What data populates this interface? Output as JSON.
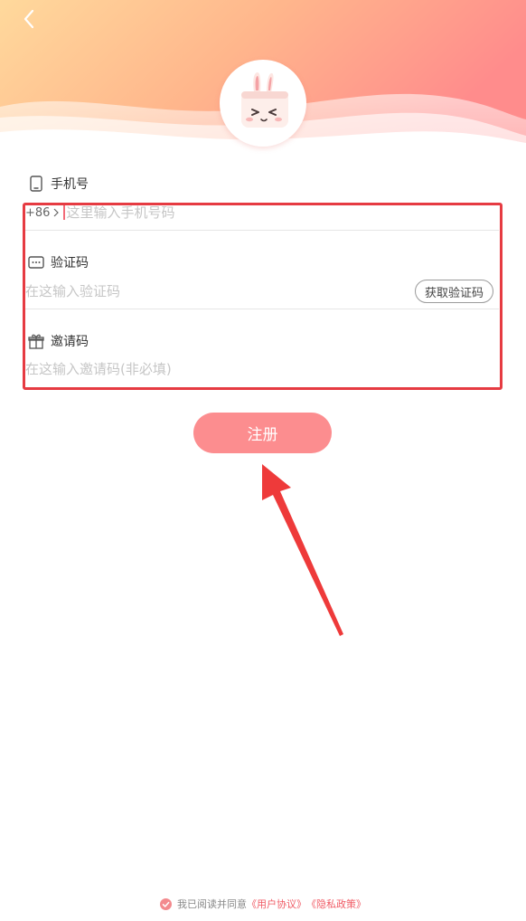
{
  "theme": {
    "accent": "#f26b78",
    "button_color": "#fc8d8f",
    "header_gradient": [
      "#ffd79a",
      "#ffa98a",
      "#ff8a8a"
    ],
    "highlight_color": "#e63b42"
  },
  "header": {
    "back_icon": "chevron-left-icon",
    "avatar": "bunny-mascot"
  },
  "form": {
    "phone": {
      "label": "手机号",
      "icon": "phone-icon",
      "country_code": "+86",
      "placeholder": "这里输入手机号码",
      "value": ""
    },
    "code": {
      "label": "验证码",
      "icon": "message-icon",
      "placeholder": "在这输入验证码",
      "value": "",
      "get_code_label": "获取验证码"
    },
    "invite": {
      "label": "邀请码",
      "icon": "gift-icon",
      "placeholder": "在这输入邀请码(非必填)",
      "value": ""
    }
  },
  "register_button": {
    "label": "注册"
  },
  "agreement": {
    "checked": true,
    "text": "我已阅读并同意",
    "user_agreement": "《用户协议》",
    "privacy_policy": "《隐私政策》"
  }
}
